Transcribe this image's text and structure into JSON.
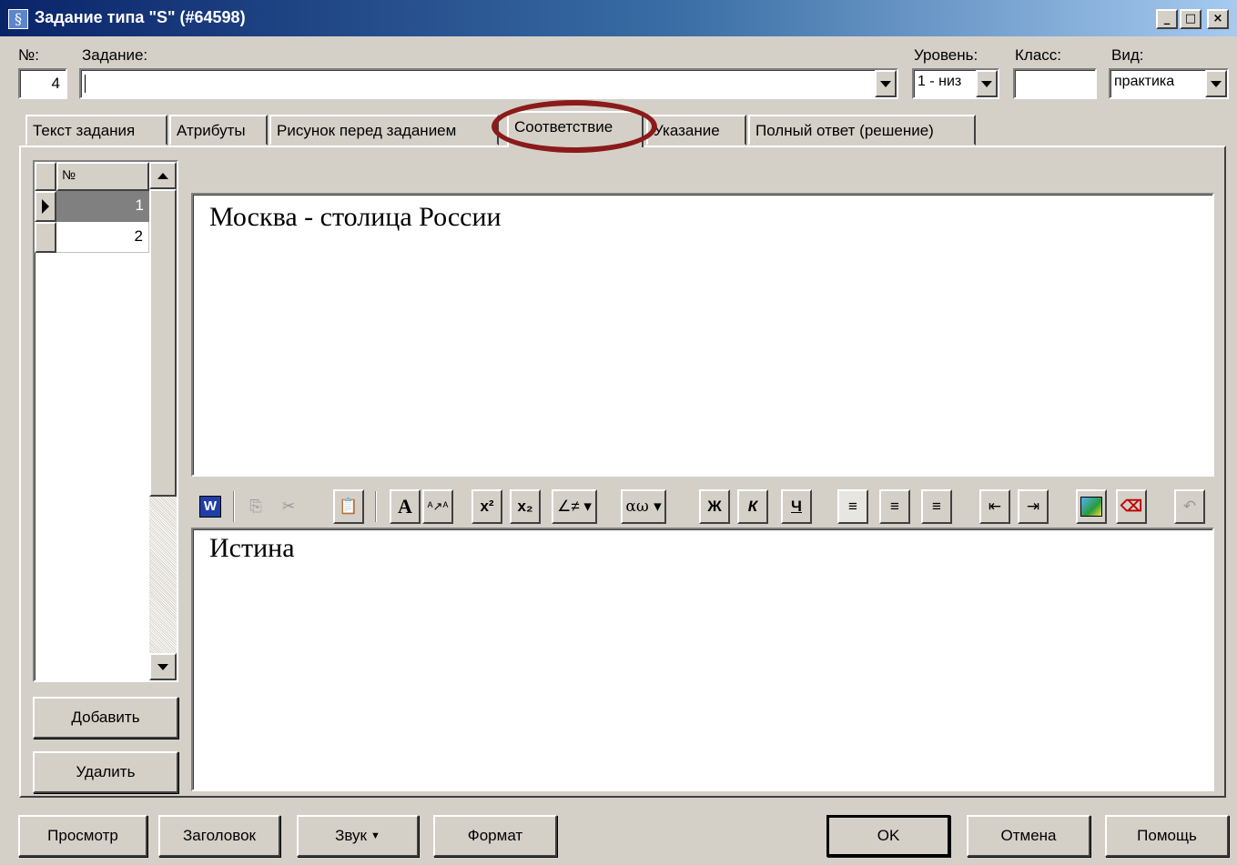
{
  "window": {
    "title": "Задание типа \"S\" (#64598)",
    "buttons": [
      "_",
      "□",
      "×"
    ]
  },
  "header": {
    "number_label": "№:",
    "number_value": "4",
    "task_label": "Задание:",
    "task_value": "",
    "level_label": "Уровень:",
    "level_value": "1 - низ",
    "class_label": "Класс:",
    "class_value": "",
    "kind_label": "Вид:",
    "kind_value": "практика"
  },
  "tabs": [
    {
      "label": "Текст задания",
      "active": false
    },
    {
      "label": "Атрибуты",
      "active": false
    },
    {
      "label": "Рисунок перед заданием",
      "active": false
    },
    {
      "label": "Соответствие",
      "active": true
    },
    {
      "label": "Указание",
      "active": false
    },
    {
      "label": "Полный ответ (решение)",
      "active": false
    }
  ],
  "grid": {
    "column_header": "№",
    "rows": [
      "1",
      "2"
    ],
    "selected_row": 0
  },
  "statement_text": "Москва - столица России",
  "answer_text": "Истина",
  "side_buttons": {
    "add": "Добавить",
    "delete": "Удалить"
  },
  "toolbar": {
    "icons": [
      "word-icon",
      "copy-icon",
      "cut-icon",
      "paste-icon",
      "font-icon",
      "font-size-icon",
      "superscript-icon",
      "subscript-icon",
      "math-symbols-icon",
      "greek-symbols-icon",
      "bold-icon",
      "italic-icon",
      "underline-icon",
      "align-left-icon",
      "align-center-icon",
      "align-right-icon",
      "outdent-icon",
      "indent-icon",
      "insert-image-icon",
      "eraser-icon",
      "undo-icon"
    ],
    "bold_glyph": "Ж",
    "italic_glyph": "К",
    "underline_glyph": "Ч"
  },
  "bottom_buttons": {
    "preview": "Просмотр",
    "heading": "Заголовок",
    "sound": "Звук",
    "format": "Формат",
    "ok": "OK",
    "cancel": "Отмена",
    "help": "Помощь"
  },
  "colors": {
    "title_start": "#0a246a",
    "title_end": "#a6caf0",
    "face": "#d4d0c8",
    "highlight_circle": "#8b1a1a"
  }
}
